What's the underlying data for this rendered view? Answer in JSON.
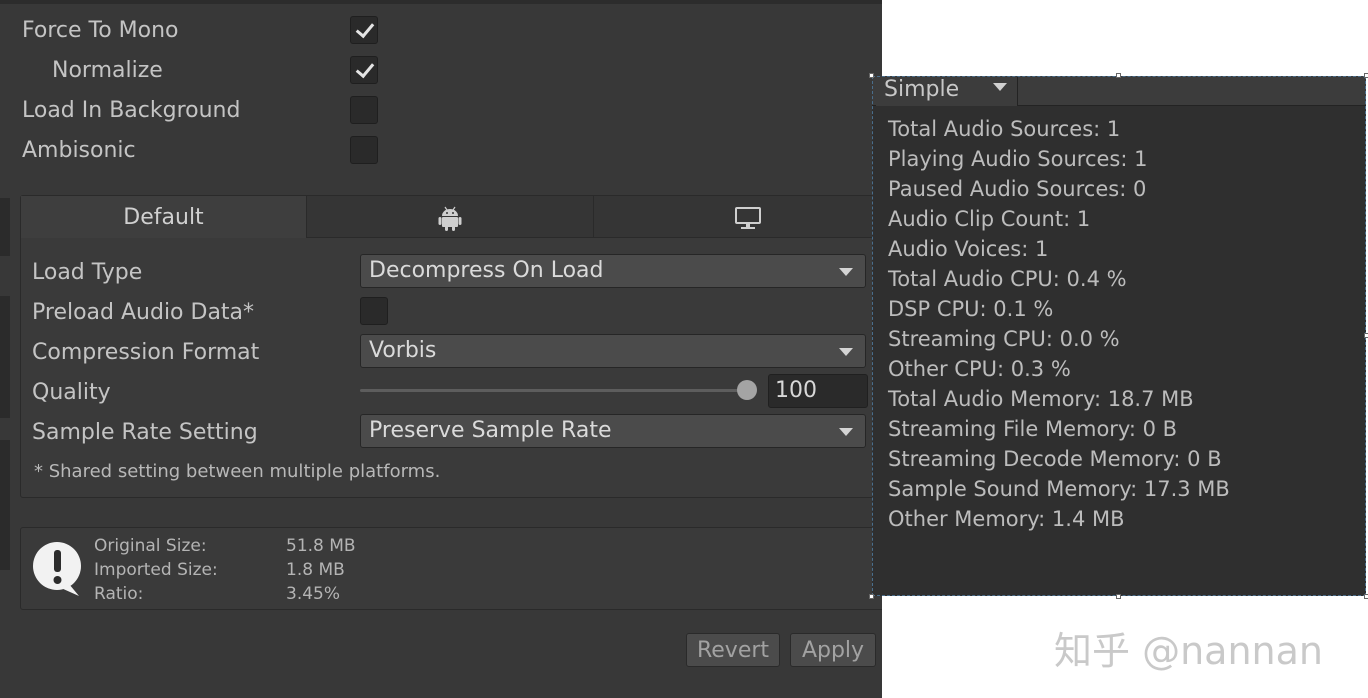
{
  "import_settings": {
    "force_to_mono": {
      "label": "Force To Mono",
      "checked": true
    },
    "normalize": {
      "label": "Normalize",
      "checked": true
    },
    "load_in_background": {
      "label": "Load In Background",
      "checked": false
    },
    "ambisonic": {
      "label": "Ambisonic",
      "checked": false
    }
  },
  "platform_tabs": {
    "default_label": "Default",
    "android_icon": "android-icon",
    "standalone_icon": "monitor-icon",
    "active": "Default"
  },
  "platform_settings": {
    "load_type": {
      "label": "Load Type",
      "value": "Decompress On Load"
    },
    "preload_audio_data": {
      "label": "Preload Audio Data*",
      "checked": false
    },
    "compression_format": {
      "label": "Compression Format",
      "value": "Vorbis"
    },
    "quality": {
      "label": "Quality",
      "value": "100",
      "slider_fraction": 1.0
    },
    "sample_rate_setting": {
      "label": "Sample Rate Setting",
      "value": "Preserve Sample Rate"
    },
    "note": "* Shared setting between multiple platforms."
  },
  "size_info": {
    "original_size_label": "Original Size:",
    "original_size_value": "51.8 MB",
    "imported_size_label": "Imported Size:",
    "imported_size_value": "1.8 MB",
    "ratio_label": "Ratio:",
    "ratio_value": "3.45%",
    "icon": "info-icon"
  },
  "actions": {
    "revert_label": "Revert",
    "apply_label": "Apply"
  },
  "profiler": {
    "mode_label": "Simple",
    "stats": [
      "Total Audio Sources: 1",
      "Playing Audio Sources: 1",
      "Paused Audio Sources: 0",
      "Audio Clip Count: 1",
      "Audio Voices: 1",
      "Total Audio CPU: 0.4 %",
      "DSP CPU: 0.1 %",
      "Streaming CPU: 0.0 %",
      "Other CPU: 0.3 %",
      "Total Audio Memory: 18.7 MB",
      "Streaming File Memory: 0 B",
      "Streaming Decode Memory: 0 B",
      "Sample Sound Memory: 17.3 MB",
      "Other Memory: 1.4 MB"
    ]
  },
  "watermark": "知乎 @nannan",
  "colors": {
    "panel_bg": "#383838",
    "field_bg": "#4b4b4b",
    "profiler_bg": "#2f2f2f",
    "text": "#c4c4c4"
  }
}
